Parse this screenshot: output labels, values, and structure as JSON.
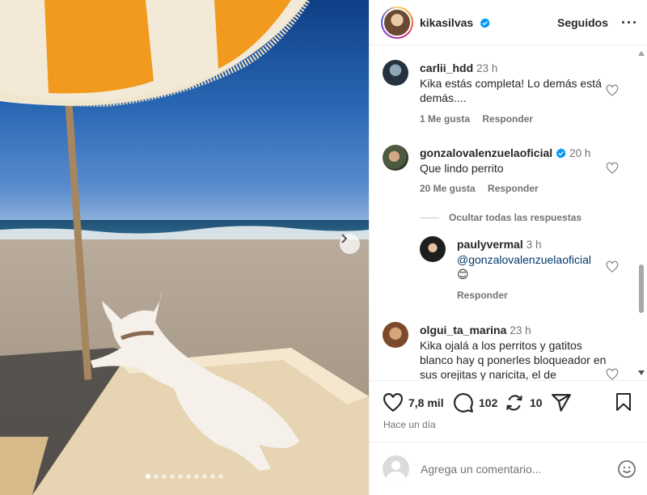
{
  "post": {
    "carousel": {
      "total": 10,
      "active": 0
    }
  },
  "header": {
    "username": "kikasilvas",
    "follow_label": "Seguidos",
    "more_label": "···"
  },
  "comments": [
    {
      "user": "carlii_hdd",
      "time": "23 h",
      "text": "Kika estás completa! Lo demás está demás....",
      "likes": "1 Me gusta",
      "reply": "Responder",
      "verified": false
    },
    {
      "user": "gonzalovalenzuelaoficial",
      "time": "20 h",
      "text": "Que lindo perrito",
      "likes": "20 Me gusta",
      "reply": "Responder",
      "verified": true
    }
  ],
  "hide_replies_label": "Ocultar todas las respuestas",
  "reply": {
    "user": "paulyvermal",
    "time": "3 h",
    "mention": "@gonzalovalenzuelaoficial",
    "emoji": "😊",
    "reply": "Responder"
  },
  "comment4": {
    "user": "olgui_ta_marina",
    "time": "23 h",
    "text": "Kika ojalá a los perritos y gatitos blanco hay q ponerles bloqueador en sus orejitas y naricita, el de"
  },
  "actions": {
    "likes": "7,8 mil",
    "comments": "102",
    "reposts": "10"
  },
  "timestamp": "Hace un día",
  "add_comment": {
    "placeholder": "Agrega un comentario..."
  },
  "colors": {
    "verified": "#0095f6",
    "muted": "#737373",
    "text": "#262626",
    "mention": "#00376b"
  },
  "icons": [
    "chevron-right-icon",
    "verified-icon",
    "more-icon",
    "heart-icon",
    "comment-icon",
    "repost-icon",
    "share-icon",
    "bookmark-icon",
    "emoji-icon"
  ]
}
